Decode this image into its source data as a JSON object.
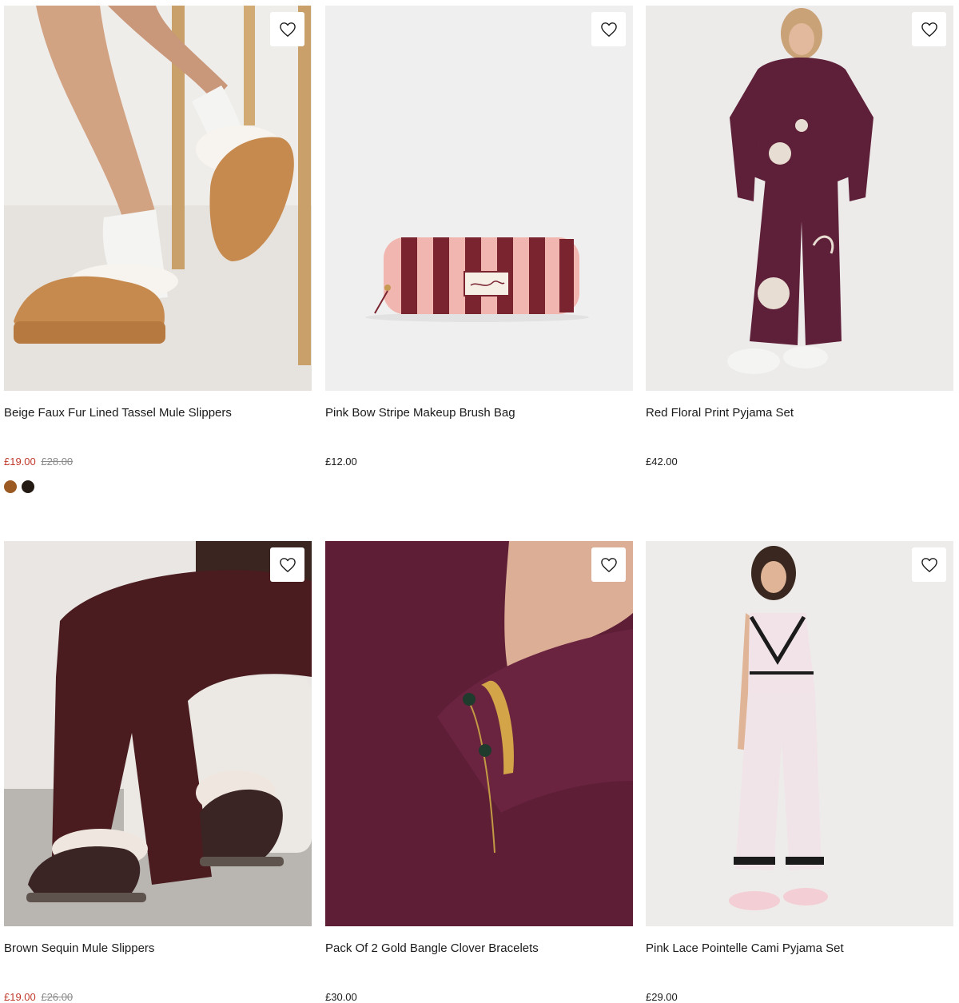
{
  "colors": {
    "sale_price": "#c0392b",
    "was_price": "#8a8a8a",
    "text": "#1a1a1a"
  },
  "products": [
    {
      "title": "Beige Faux Fur Lined Tassel Mule Slippers",
      "sale_price": "£19.00",
      "was_price": "£28.00",
      "icon": "heart-outline-icon",
      "swatches": [
        "#9a5a22",
        "#241a14"
      ]
    },
    {
      "title": "Pink Bow Stripe Makeup Brush Bag",
      "price": "£12.00",
      "icon": "heart-outline-icon"
    },
    {
      "title": "Red Floral Print Pyjama Set",
      "price": "£42.00",
      "icon": "heart-outline-icon"
    },
    {
      "title": "Brown Sequin Mule Slippers",
      "sale_price": "£19.00",
      "was_price": "£26.00",
      "icon": "heart-outline-icon"
    },
    {
      "title": "Pack Of 2 Gold Bangle Clover Bracelets",
      "price": "£30.00",
      "icon": "heart-outline-icon"
    },
    {
      "title": "Pink Lace Pointelle Cami Pyjama Set",
      "price": "£29.00",
      "icon": "heart-outline-icon"
    }
  ]
}
